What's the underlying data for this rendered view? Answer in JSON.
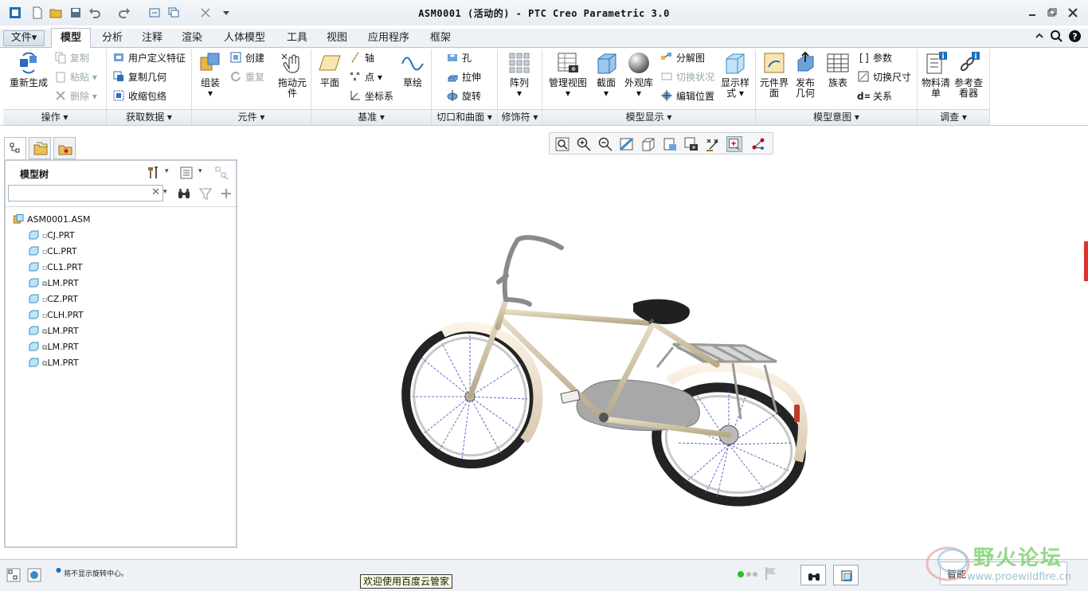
{
  "title": "ASM0001 (活动的) - PTC Creo Parametric 3.0",
  "tabs": [
    "文件",
    "模型",
    "分析",
    "注释",
    "渲染",
    "人体模型",
    "工具",
    "视图",
    "应用程序",
    "框架"
  ],
  "file_dropdown": "▾",
  "ribbon": {
    "operations": {
      "regenerate": "重新生成",
      "copy": "复制",
      "paste": "粘贴",
      "delete": "删除",
      "group": "操作"
    },
    "get_data": {
      "udf": "用户定义特征",
      "copy_geom": "复制几何",
      "shrinkwrap": "收缩包络",
      "group": "获取数据"
    },
    "component": {
      "assemble": "组装",
      "create": "创建",
      "repeat": "重复",
      "drag": "拖动元件",
      "group": "元件"
    },
    "datum": {
      "plane": "平面",
      "axis": "轴",
      "point": "点",
      "csys": "坐标系",
      "sketch": "草绘",
      "group": "基准"
    },
    "cut_surface": {
      "hole": "孔",
      "extrude": "拉伸",
      "revolve": "旋转",
      "group": "切口和曲面"
    },
    "modifiers": {
      "pattern": "阵列",
      "group": "修饰符"
    },
    "model_display": {
      "manage_views": "管理视图",
      "section": "截面",
      "appearance": "外观库",
      "explode": "分解图",
      "toggle_status": "切换状况",
      "edit_position": "编辑位置",
      "display_style": "显示样式",
      "group": "模型显示"
    },
    "model_intent": {
      "comp_interface": "元件界面",
      "publish_geom": "发布几何",
      "family_table": "族表",
      "parameters": "参数",
      "switch_dims": "切换尺寸",
      "relations": "关系",
      "group": "模型意图"
    },
    "investigate": {
      "bom": "物料清单",
      "ref_viewer": "参考查看器",
      "group": "调查"
    }
  },
  "model_tree": {
    "title": "模型树",
    "root": "ASM0001.ASM",
    "items": [
      "CJ.PRT",
      "CL.PRT",
      "CL1.PRT",
      "LM.PRT",
      "CZ.PRT",
      "CLH.PRT",
      "LM.PRT",
      "LM.PRT",
      "LM.PRT"
    ]
  },
  "status": {
    "message": "将不显示旋转中心。",
    "tooltip": "欢迎使用百度云管家",
    "filter": "智能"
  },
  "watermark": {
    "text": "野火论坛",
    "url": "www.proewildfire.cn"
  },
  "colors": {
    "accent": "#1d6fb8",
    "frame": "#cfc4a6",
    "tire": "#232323",
    "saddle": "#202020"
  }
}
